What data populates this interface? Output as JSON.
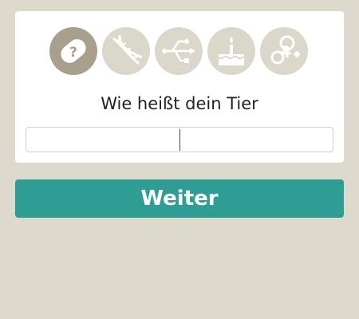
{
  "colors": {
    "background": "#ddd9cc",
    "card": "#ffffff",
    "step_inactive": "#dbd8cb",
    "step_active": "#a8a08c",
    "icon_inactive": "#ffffff",
    "accent": "#2e9e95"
  },
  "steps": [
    {
      "icon": "chip-question-icon",
      "state": "active"
    },
    {
      "icon": "dna-icon",
      "state": "inactive"
    },
    {
      "icon": "usb-icon",
      "state": "inactive"
    },
    {
      "icon": "birthday-cake-icon",
      "state": "inactive"
    },
    {
      "icon": "gender-icon",
      "state": "inactive"
    }
  ],
  "form": {
    "question": "Wie heißt dein Tier",
    "name_value": ""
  },
  "actions": {
    "next_label": "Weiter"
  }
}
